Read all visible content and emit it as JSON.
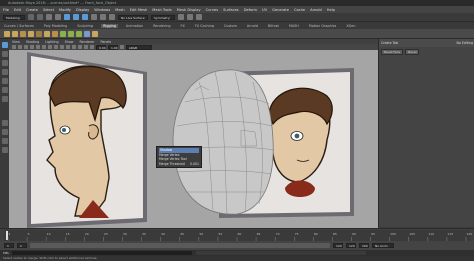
{
  "app": {
    "title": "Autodesk Maya 2016: ...scenes/untitled* --- Front_face_Object"
  },
  "menubar": {
    "items": [
      "File",
      "Edit",
      "Create",
      "Select",
      "Modify",
      "Display",
      "Windows",
      "Mesh",
      "Edit Mesh",
      "Mesh Tools",
      "Mesh Display",
      "Curves",
      "Surfaces",
      "Deform",
      "UV",
      "Generate",
      "Cache",
      "Arnold",
      "Help"
    ]
  },
  "statusline": {
    "mode": "Modeling",
    "live_surface": "No Live Surface",
    "symmetry": "Symmetry: Off"
  },
  "shelf_tabs": {
    "items": [
      "Curves / Surfaces",
      "Poly Modeling",
      "Sculpting",
      "Rigging",
      "Animation",
      "Rendering",
      "FX",
      "FX Caching",
      "Custom",
      "Arnold",
      "Bifrost",
      "MASH",
      "Motion Graphics",
      "XGen"
    ],
    "active_index": 3
  },
  "viewport": {
    "menu": [
      "View",
      "Shading",
      "Lighting",
      "Show",
      "Renderer",
      "Panels"
    ],
    "camera_label": "sRGB gamma",
    "field_value_1": "0.00",
    "field_value_2": "1.00"
  },
  "tooltip": {
    "title": "Shadow",
    "rows": [
      "Merge Vertex",
      "Merge Vertex Tool",
      "Merge Threshold"
    ],
    "value": "0.001"
  },
  "right_panel": {
    "header": "Create Tab",
    "sub": "No Editing",
    "btn1": "Bevel Face",
    "btn2": "Bevel"
  },
  "timeline": {
    "ticks": [
      "1",
      "5",
      "10",
      "15",
      "20",
      "25",
      "30",
      "35",
      "40",
      "45",
      "50",
      "55",
      "60",
      "65",
      "70",
      "75",
      "80",
      "85",
      "90",
      "95",
      "100",
      "105",
      "110",
      "115",
      "120"
    ],
    "current_frame": "1"
  },
  "range": {
    "start": "1",
    "start_inner": "1",
    "end_inner": "120",
    "end": "120",
    "end2": "200",
    "anim_layer": "No Anim Layer",
    "character": "No Character Set"
  },
  "cmdline": {
    "label": "MEL"
  },
  "helpline": {
    "text": "Select vertex to merge. Shift-click to select additional vertices."
  },
  "colors": {
    "viewport_bg": "#a5a5a5",
    "skin": "#e2c8a4",
    "hair": "#5a3a22",
    "mesh": "#c8c8c8",
    "selection": "#5b9bd5"
  }
}
